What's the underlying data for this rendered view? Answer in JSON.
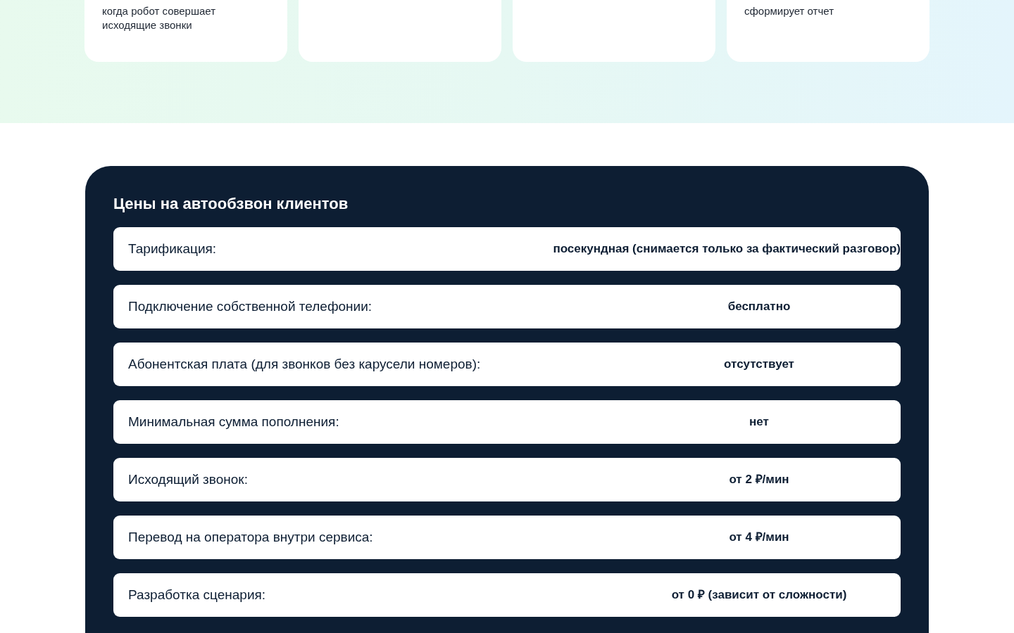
{
  "feature_cards": [
    {
      "kind": "text",
      "lines": [
        "когда робот совершает",
        "исходящие звонки"
      ]
    },
    {
      "kind": "blank"
    },
    {
      "kind": "blank"
    },
    {
      "kind": "text",
      "lines": [
        "сформирует отчет"
      ]
    }
  ],
  "pricing": {
    "title": "Цены на автообзвон клиентов",
    "rows": [
      {
        "label": "Тарификация:",
        "value": "посекундная (снимается только за фактический разговор)"
      },
      {
        "label": "Подключение собственной телефонии:",
        "value": "бесплатно"
      },
      {
        "label": "Абонентская плата (для звонков без карусели номеров):",
        "value": "отсутствует"
      },
      {
        "label": "Минимальная сумма пополнения:",
        "value": "нет"
      },
      {
        "label": "Исходящий звонок:",
        "value": "от 2 ₽/мин"
      },
      {
        "label": "Перевод на оператора внутри сервиса:",
        "value": "от 4 ₽/мин"
      },
      {
        "label": "Разработка сценария:",
        "value": "от 0 ₽ (зависит от сложности)"
      }
    ]
  }
}
